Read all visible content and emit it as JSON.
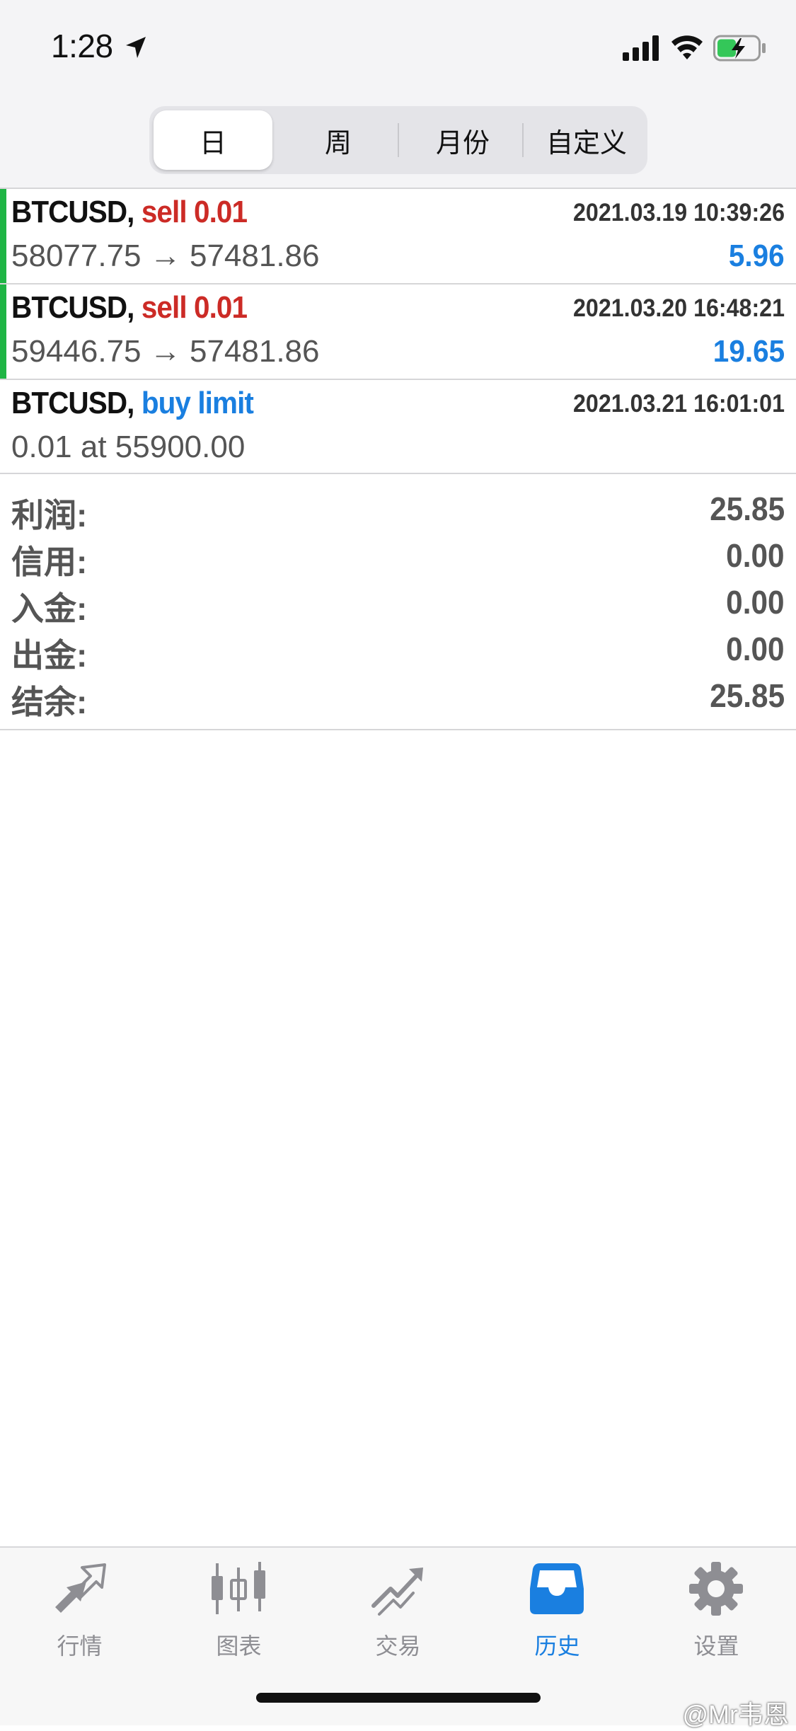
{
  "status_bar": {
    "time": "1:28"
  },
  "period_tabs": [
    "日",
    "周",
    "月份",
    "自定义"
  ],
  "active_period": "日",
  "orders": [
    {
      "symbol": "BTCUSD,",
      "side": "sell 0.01",
      "time": "2021.03.19 10:39:26",
      "detail": "58077.75 → 57481.86",
      "profit": "5.96"
    },
    {
      "symbol": "BTCUSD,",
      "side": "sell 0.01",
      "time": "2021.03.20 16:48:21",
      "detail": "59446.75 → 57481.86",
      "profit": "19.65"
    },
    {
      "symbol": "BTCUSD,",
      "side": "buy limit",
      "time": "2021.03.21 16:01:01",
      "detail": "0.01 at 55900.00",
      "profit": ""
    }
  ],
  "summary": [
    {
      "label": "利润:",
      "value": "25.85"
    },
    {
      "label": "信用:",
      "value": "0.00"
    },
    {
      "label": "入金:",
      "value": "0.00"
    },
    {
      "label": "出金:",
      "value": "0.00"
    },
    {
      "label": "结余:",
      "value": "25.85"
    }
  ],
  "tab_bar": [
    {
      "label": "行情",
      "icon": "quotes-arrows-icon"
    },
    {
      "label": "图表",
      "icon": "candlestick-chart-icon"
    },
    {
      "label": "交易",
      "icon": "trade-chart-icon"
    },
    {
      "label": "历史",
      "icon": "history-inbox-icon"
    },
    {
      "label": "设置",
      "icon": "settings-gear-icon"
    }
  ],
  "active_tab": "历史",
  "watermark": "@Mr韦恩",
  "colors": {
    "sell": "#cc2b26",
    "buy": "#1a7fe0",
    "profit": "#1a7fe0",
    "position_bar": "#1fb545",
    "active_tab": "#1a7fe0",
    "inactive_tab": "#8e8e93"
  }
}
